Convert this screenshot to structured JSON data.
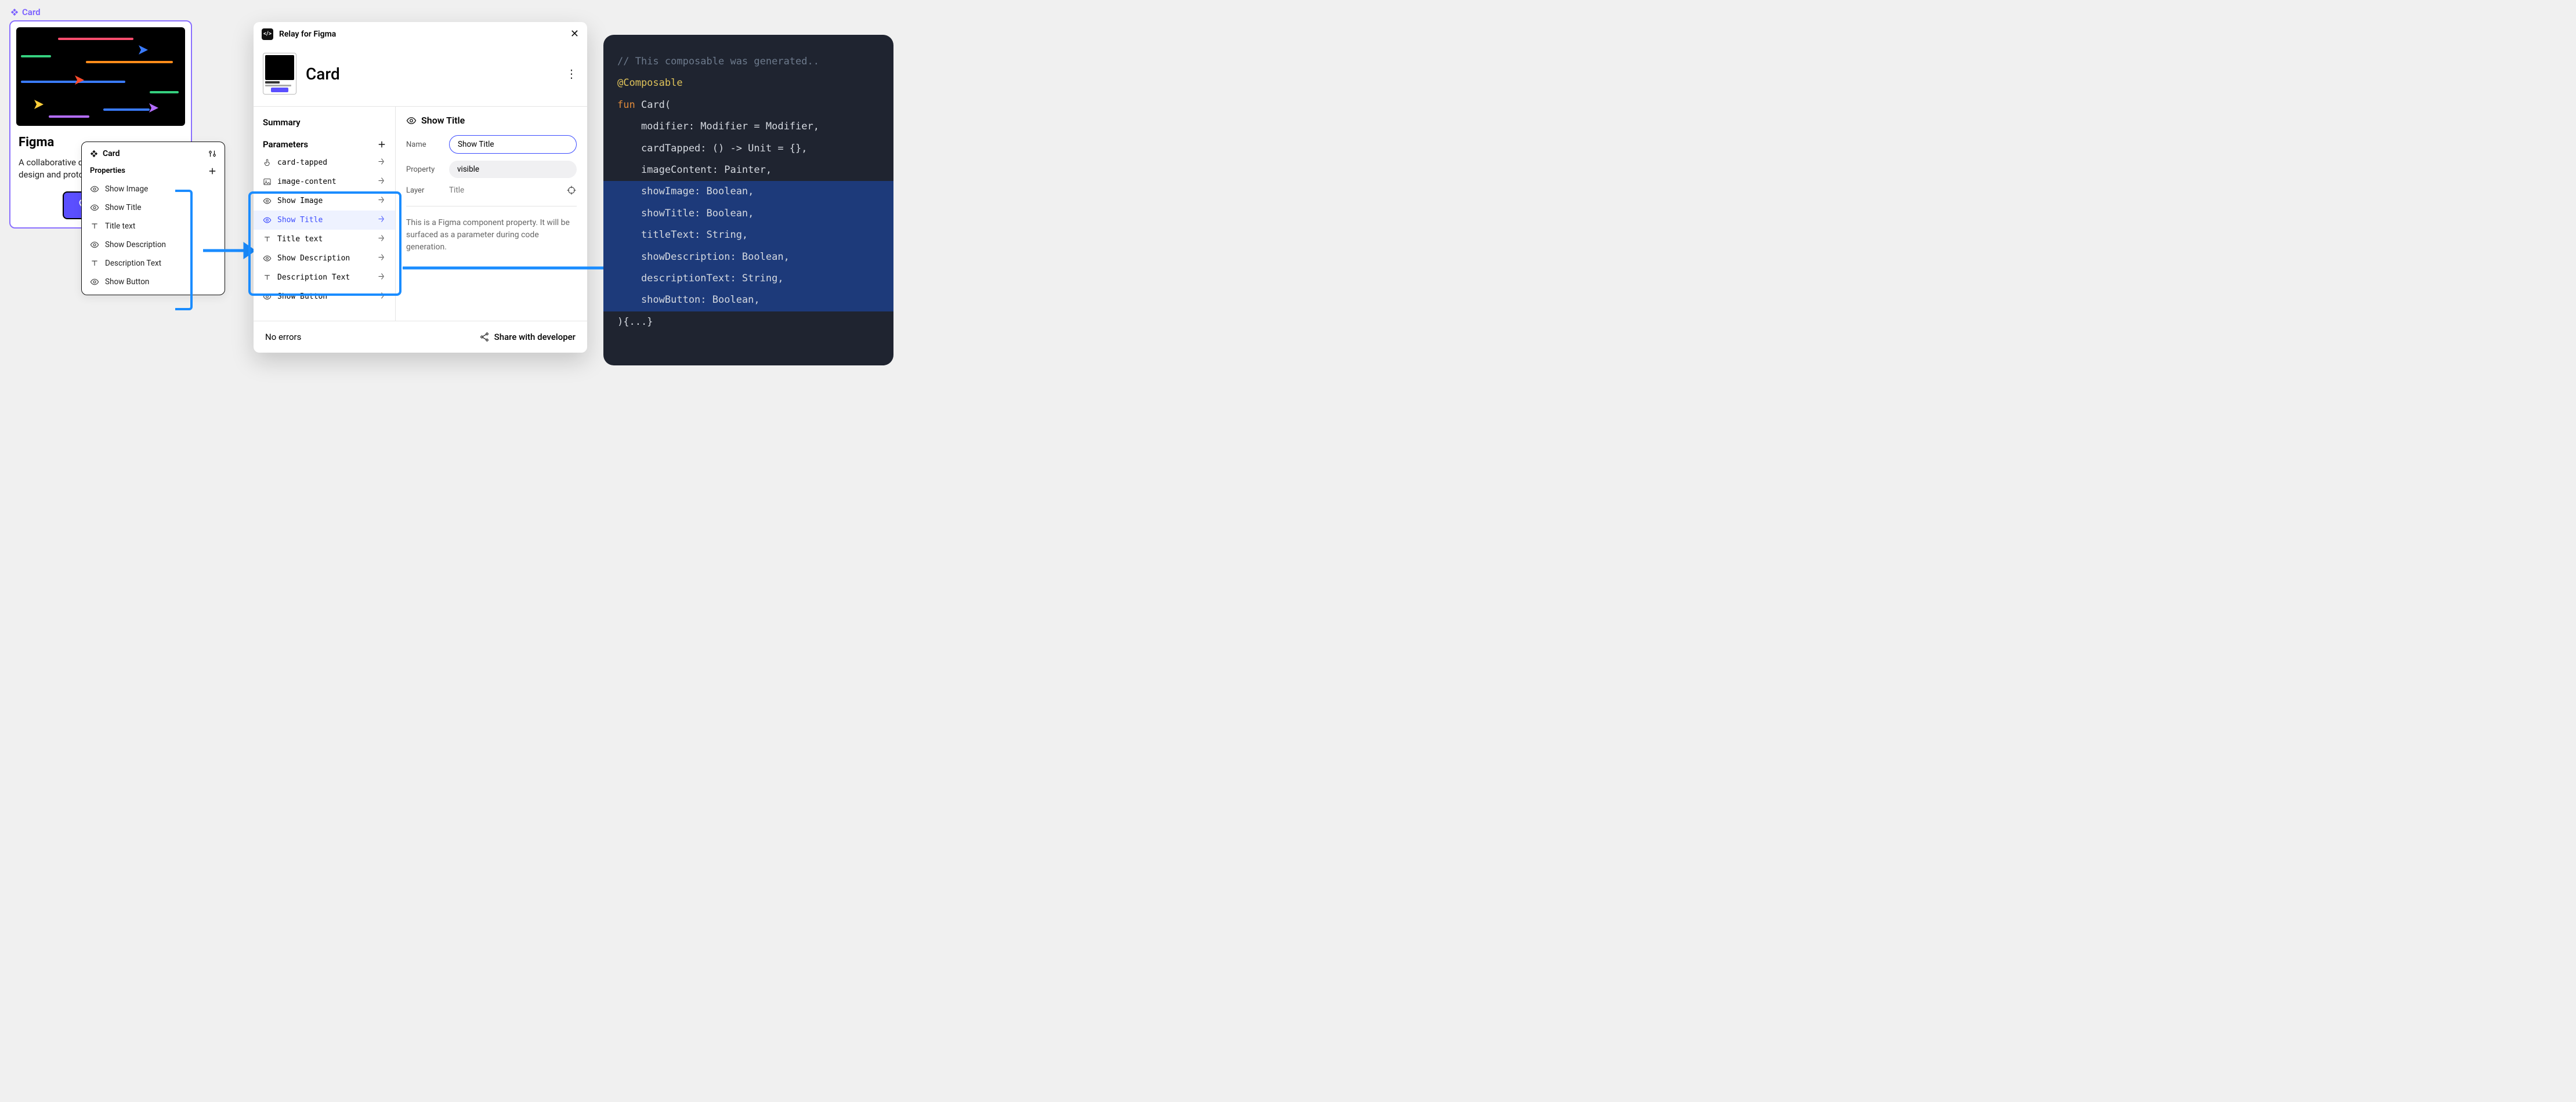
{
  "component_badge": "Card",
  "card": {
    "title": "Figma",
    "description": "A collaborative design tool for teams to design and prototype together.",
    "button_label": "Button"
  },
  "props_panel": {
    "header": "Card",
    "section": "Properties",
    "items": [
      {
        "icon": "eye",
        "label": "Show Image"
      },
      {
        "icon": "eye",
        "label": "Show Title"
      },
      {
        "icon": "text",
        "label": "Title text"
      },
      {
        "icon": "eye",
        "label": "Show Description"
      },
      {
        "icon": "text",
        "label": "Description Text"
      },
      {
        "icon": "eye",
        "label": "Show Button"
      }
    ]
  },
  "relay": {
    "plugin_name": "Relay for Figma",
    "title": "Card",
    "summary_label": "Summary",
    "parameters_label": "Parameters",
    "params": [
      {
        "icon": "tap",
        "label": "card-tapped",
        "active": false
      },
      {
        "icon": "img",
        "label": "image-content",
        "active": false
      },
      {
        "icon": "eye",
        "label": "Show Image",
        "active": false
      },
      {
        "icon": "eye",
        "label": "Show Title",
        "active": true
      },
      {
        "icon": "text",
        "label": "Title text",
        "active": false
      },
      {
        "icon": "eye",
        "label": "Show Description",
        "active": false
      },
      {
        "icon": "text",
        "label": "Description Text",
        "active": false
      },
      {
        "icon": "eye",
        "label": "Show Button",
        "active": false
      }
    ],
    "detail_heading": "Show Title",
    "name_label": "Name",
    "name_value": "Show Title",
    "property_label": "Property",
    "property_value": "visible",
    "layer_label": "Layer",
    "layer_value": "Title",
    "hint": "This is a Figma component property. It will be surfaced as a parameter during code generation.",
    "footer_status": "No errors",
    "footer_action": "Share with developer"
  },
  "code": {
    "lines": [
      {
        "cls": "c-comment",
        "text": "// This composable was generated.."
      },
      {
        "cls": "c-ann",
        "text": "@Composable"
      },
      {
        "html": "<span class='c-kw'>fun</span> <span class='c-fn'>Card</span>("
      },
      {
        "text": "    modifier: Modifier = Modifier,"
      },
      {
        "text": "    cardTapped: () -> Unit = {},"
      },
      {
        "text": "    imageContent: Painter,"
      },
      {
        "text": "    showImage: Boolean,",
        "hl": true
      },
      {
        "text": "    showTitle: Boolean,",
        "hl": true
      },
      {
        "text": "    titleText: String,",
        "hl": true
      },
      {
        "text": "    showDescription: Boolean,",
        "hl": true
      },
      {
        "text": "    descriptionText: String,",
        "hl": true
      },
      {
        "text": "    showButton: Boolean,",
        "hl": true
      },
      {
        "text": "){...}"
      }
    ]
  }
}
